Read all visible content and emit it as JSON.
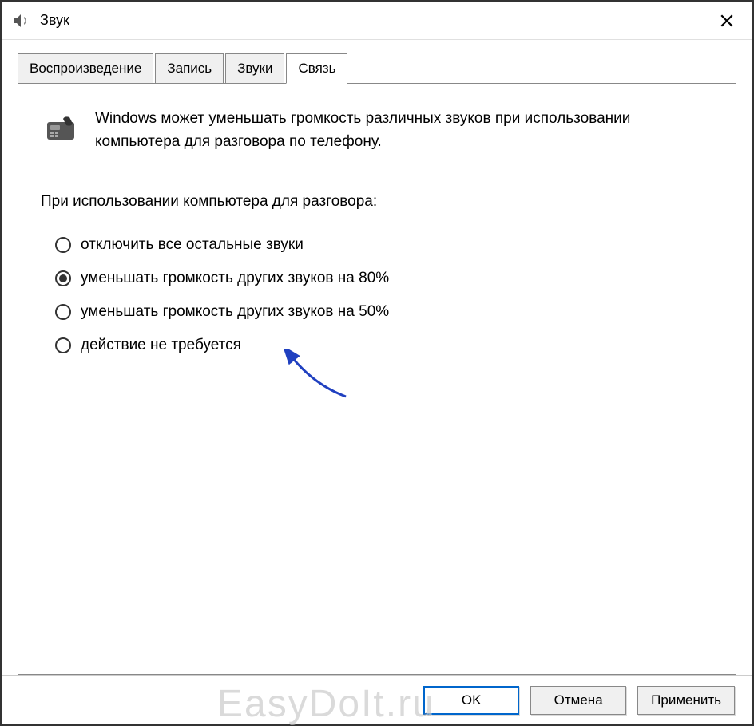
{
  "window": {
    "title": "Звук"
  },
  "tabs": [
    {
      "label": "Воспроизведение",
      "active": false
    },
    {
      "label": "Запись",
      "active": false
    },
    {
      "label": "Звуки",
      "active": false
    },
    {
      "label": "Связь",
      "active": true
    }
  ],
  "content": {
    "info_text": "Windows может уменьшать громкость различных звуков при использовании компьютера для разговора по телефону.",
    "section_label": "При использовании компьютера для разговора:",
    "radio_options": [
      {
        "label": "отключить все остальные звуки",
        "checked": false
      },
      {
        "label": "уменьшать громкость других звуков на 80%",
        "checked": true
      },
      {
        "label": "уменьшать громкость других звуков на 50%",
        "checked": false
      },
      {
        "label": "действие не требуется",
        "checked": false
      }
    ]
  },
  "buttons": {
    "ok": "OK",
    "cancel": "Отмена",
    "apply": "Применить"
  },
  "watermark": "EasyDoIt.ru"
}
